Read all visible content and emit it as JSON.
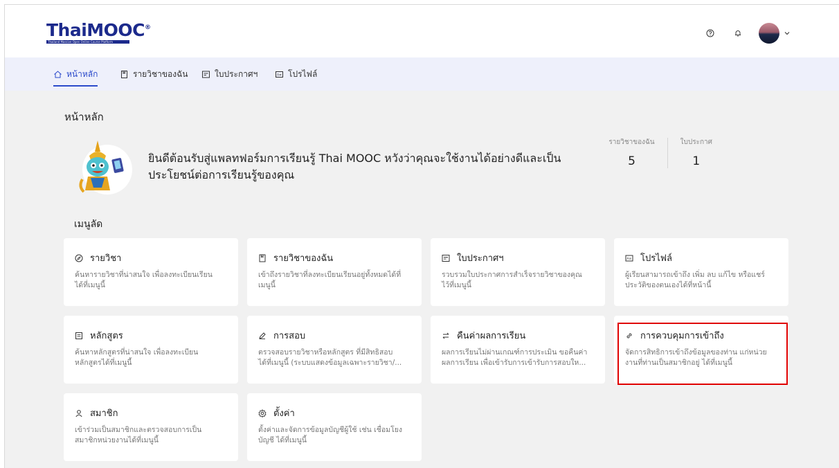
{
  "brand": {
    "logo_text": "ThaiMOOC",
    "logo_registered": "®",
    "logo_subtitle": "Thailand Massive Open Online Course Platform"
  },
  "header": {
    "icons": [
      "help-circle-icon",
      "bell-icon",
      "avatar",
      "chevron-down-icon"
    ]
  },
  "nav": {
    "items": [
      {
        "label": "หน้าหลัก",
        "icon": "home-icon",
        "active": true
      },
      {
        "label": "รายวิชาของฉัน",
        "icon": "bookmark-icon",
        "active": false
      },
      {
        "label": "ใบประกาศฯ",
        "icon": "certificate-icon",
        "active": false
      },
      {
        "label": "โปรไฟล์",
        "icon": "id-card-icon",
        "active": false
      }
    ]
  },
  "page": {
    "title": "หน้าหลัก",
    "welcome_line1": "ยินดีต้อนรับสู่แพลทฟอร์มการเรียนรู้ Thai MOOC หวังว่าคุณจะใช้งานได้อย่างดีและเป็น",
    "welcome_line2": "ประโยชน์ต่อการเรียนรู้ของคุณ",
    "stats": [
      {
        "label": "รายวิชาของฉัน",
        "value": "5"
      },
      {
        "label": "ใบประกาศ",
        "value": "1"
      }
    ],
    "quick_menu_title": "เมนูลัด"
  },
  "cards": [
    {
      "title": "รายวิชา",
      "icon": "compass-icon",
      "desc1": "ค้นหารายวิชาที่น่าสนใจ เพื่อลงทะเบียนเรียน",
      "desc2": "ได้ที่เมนูนี้"
    },
    {
      "title": "รายวิชาของฉัน",
      "icon": "bookmark-icon",
      "desc1": "เข้าถึงรายวิชาที่ลงทะเบียนเรียนอยู่ทั้งหมดได้ที่",
      "desc2": "เมนูนี้"
    },
    {
      "title": "ใบประกาศฯ",
      "icon": "certificate-icon",
      "desc1": "รวบรวมใบประกาศการสำเร็จรายวิชาของคุณ",
      "desc2": "ไว้ที่เมนูนี้"
    },
    {
      "title": "โปรไฟล์",
      "icon": "id-card-icon",
      "desc1": "ผู้เรียนสามารถเข้าถึง เพิ่ม ลบ แก้ไข หรือแชร์",
      "desc2": "ประวัติของตนเองได้ที่หน้านี้"
    },
    {
      "title": "หลักสูตร",
      "icon": "list-box-icon",
      "desc1": "ค้นหาหลักสูตรที่น่าสนใจ เพื่อลงทะเบียน",
      "desc2": "หลักสูตรได้ที่เมนูนี้"
    },
    {
      "title": "การสอบ",
      "icon": "pen-icon",
      "desc1": "ตรวจสอบรายวิชาหรือหลักสูตร ที่มีสิทธิสอบ",
      "desc2": "ได้ที่เมนูนี้ (ระบบแสดงข้อมูลเฉพาะรายวิชา/..."
    },
    {
      "title": "คืนค่าผลการเรียน",
      "icon": "swap-icon",
      "desc1": "ผลการเรียนไม่ผ่านเกณฑ์การประเมิน ขอคืนค่า",
      "desc2": "ผลการเรียน เพื่อเข้ารับการเข้ารับการสอบให..."
    },
    {
      "title": "การควบคุมการเข้าถึง",
      "icon": "link-icon",
      "desc1": "จัดการสิทธิการเข้าถึงข้อมูลของท่าน แก่หน่วย",
      "desc2": "งานที่ท่านเป็นสมาชิกอยู่ ได้ที่เมนูนี้"
    },
    {
      "title": "สมาชิก",
      "icon": "user-icon",
      "desc1": "เข้าร่วมเป็นสมาชิกและตรวจสอบการเป็น",
      "desc2": "สมาชิกหน่วยงานได้ที่เมนูนี้"
    },
    {
      "title": "ตั้งค่า",
      "icon": "gear-icon",
      "desc1": "ตั้งค่าและจัดการข้อมูลบัญชีผู้ใช้ เช่น เชื่อมโยง",
      "desc2": "บัญชี ได้ที่เมนูนี้"
    }
  ],
  "colors": {
    "accent": "#2b4acb",
    "brand": "#1c2a8c",
    "nav_bg": "#eef0fb",
    "page_bg": "#f1f1f1",
    "highlight": "#e00000"
  }
}
